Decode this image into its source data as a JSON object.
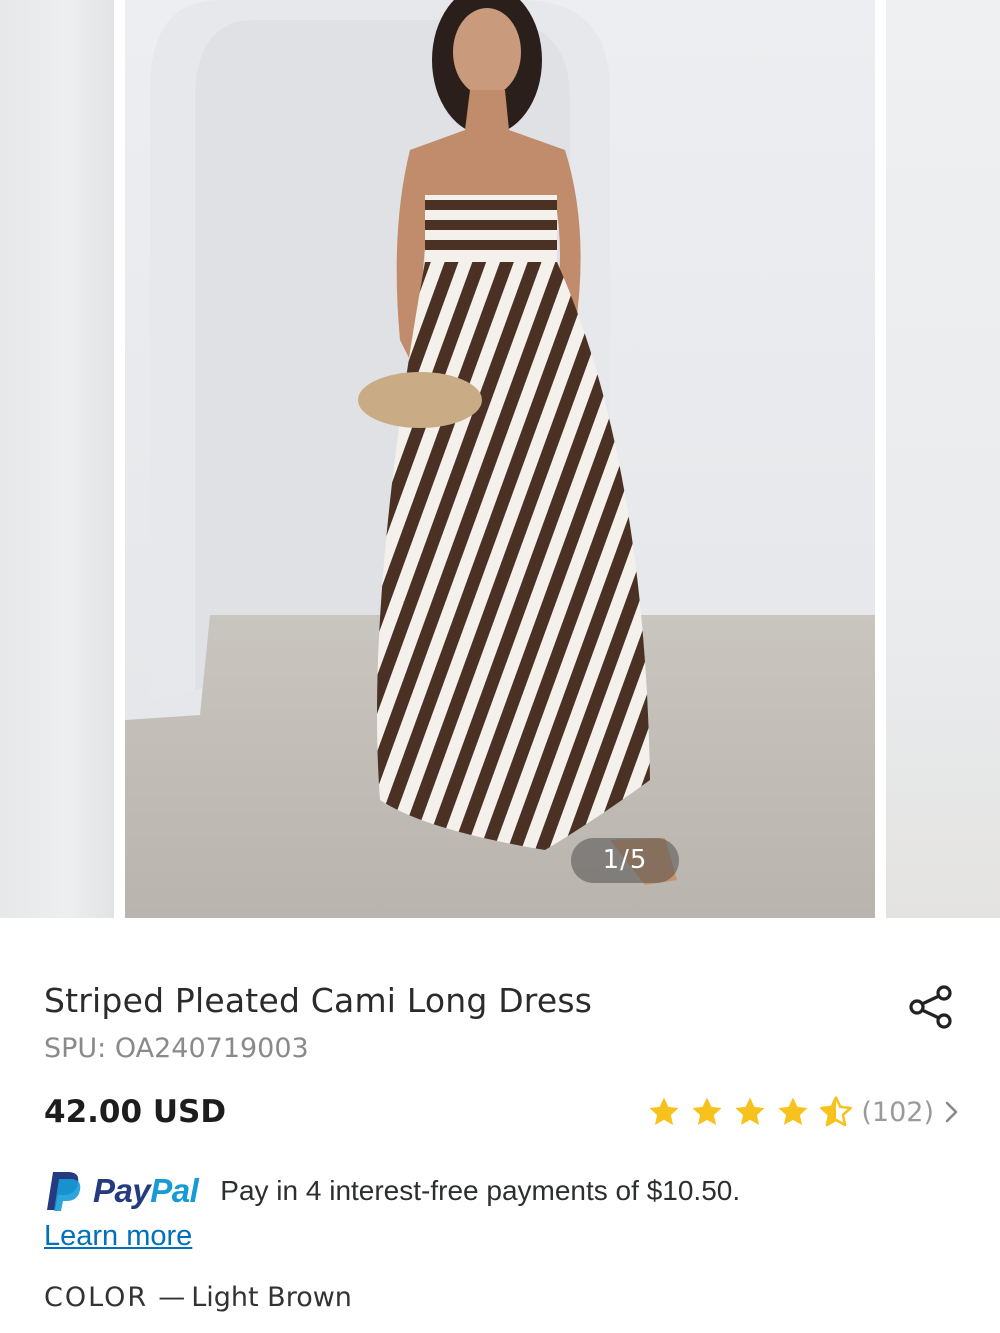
{
  "gallery": {
    "counter": "1/5",
    "current_index": 1,
    "total": 5
  },
  "product": {
    "title": "Striped Pleated Cami Long Dress",
    "spu": "SPU: OA240719003",
    "price": "42.00 USD",
    "rating": {
      "stars": 4.5,
      "max": 5,
      "count": "(102)",
      "star_color": "#f7c21b"
    }
  },
  "paypal": {
    "brand_pay": "Pay",
    "brand_pal": "Pal",
    "message": "Pay in 4 interest-free payments of $10.50.",
    "learn_more": "Learn more"
  },
  "color": {
    "label": "COLOR",
    "separator": "—",
    "value": "Light Brown"
  },
  "icons": {
    "share": "share-icon",
    "chevron": "chevron-right-icon",
    "paypal": "paypal-logo-icon"
  }
}
